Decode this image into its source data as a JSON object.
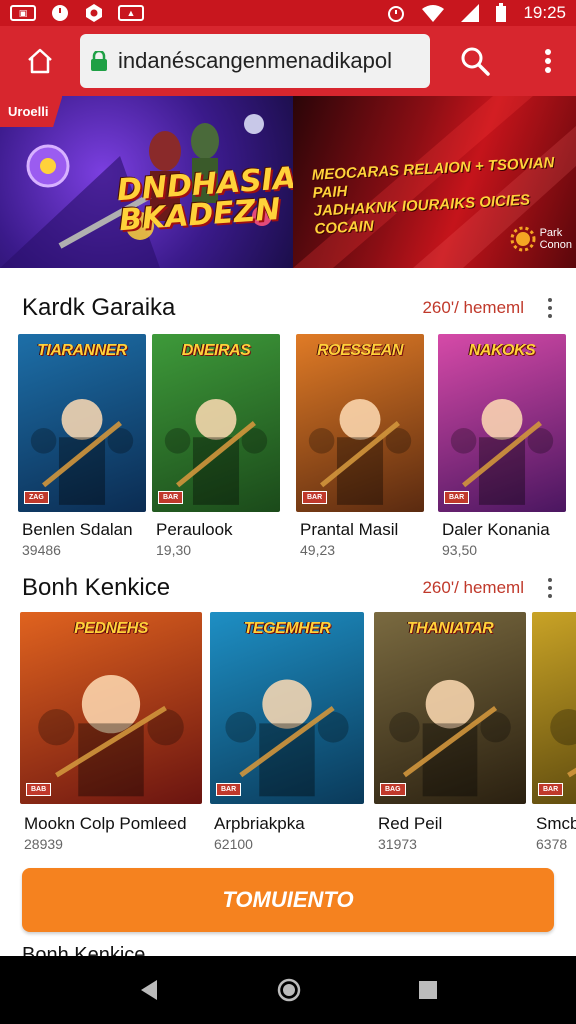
{
  "status_bar": {
    "time": "19:25",
    "left_icons": [
      "image-icon",
      "clock-icon",
      "settings-icon",
      "photo-icon"
    ],
    "right_icons": [
      "alarm-icon",
      "wifi-icon",
      "signal-icon",
      "battery-icon"
    ]
  },
  "browser": {
    "url": "indanéscangenmenadikapol"
  },
  "banner": {
    "tag": "Uroelli",
    "title_line1": "DNDHASIA",
    "title_line2": "BKADEZN",
    "right_text_line1": "MEOCARAS RELAION + TSOVIAN PAIH",
    "right_text_line2": "JADHAKNK IOURAIKS OICIES COCAIN",
    "logo_line1": "Park",
    "logo_line2": "Conon"
  },
  "sections": [
    {
      "title": "Kardk Garaika",
      "link": "260'/ hememl",
      "items": [
        {
          "name": "Benlen Sdalan",
          "count": "39486",
          "cover_title": "TIARANNER",
          "badge": "ZAG",
          "colors": [
            "#1d6fa8",
            "#0b2c52"
          ]
        },
        {
          "name": "Peraulook",
          "count": "19,30",
          "cover_title": "DNEIRAS",
          "badge": "BAR",
          "colors": [
            "#3e9a3a",
            "#1b4a1a"
          ]
        },
        {
          "name": "Prantal Masil",
          "count": "49,23",
          "cover_title": "ROESSEAN",
          "badge": "BAR",
          "colors": [
            "#e07b26",
            "#5a2a10"
          ]
        },
        {
          "name": "Daler Konania",
          "count": "93,50",
          "cover_title": "NAKOKS",
          "badge": "BAR",
          "colors": [
            "#d64aa8",
            "#4a1660"
          ]
        }
      ]
    },
    {
      "title": "Bonh Kenkice",
      "link": "260'/ hememl",
      "items": [
        {
          "name": "Mookn Colp Pomleed",
          "count": "28939",
          "cover_title": "PEDNEHS",
          "badge": "BAB",
          "colors": [
            "#e0631f",
            "#6a1410"
          ]
        },
        {
          "name": "Arpbriakpka",
          "count": "62100",
          "cover_title": "TEGEMHER",
          "badge": "BAR",
          "colors": [
            "#1e8fc4",
            "#0a3a5a"
          ]
        },
        {
          "name": "Red Peil",
          "count": "31973",
          "cover_title": "THANIATAR",
          "badge": "BAG",
          "colors": [
            "#7a6a40",
            "#2a2010"
          ]
        },
        {
          "name": "Smcb",
          "count": "6378",
          "cover_title": "TH",
          "badge": "BAR",
          "colors": [
            "#c9a326",
            "#4a3a0a"
          ]
        }
      ]
    }
  ],
  "cta": {
    "label": "TOMUIENTO"
  },
  "next_section_title": "Bonh Kenkice"
}
